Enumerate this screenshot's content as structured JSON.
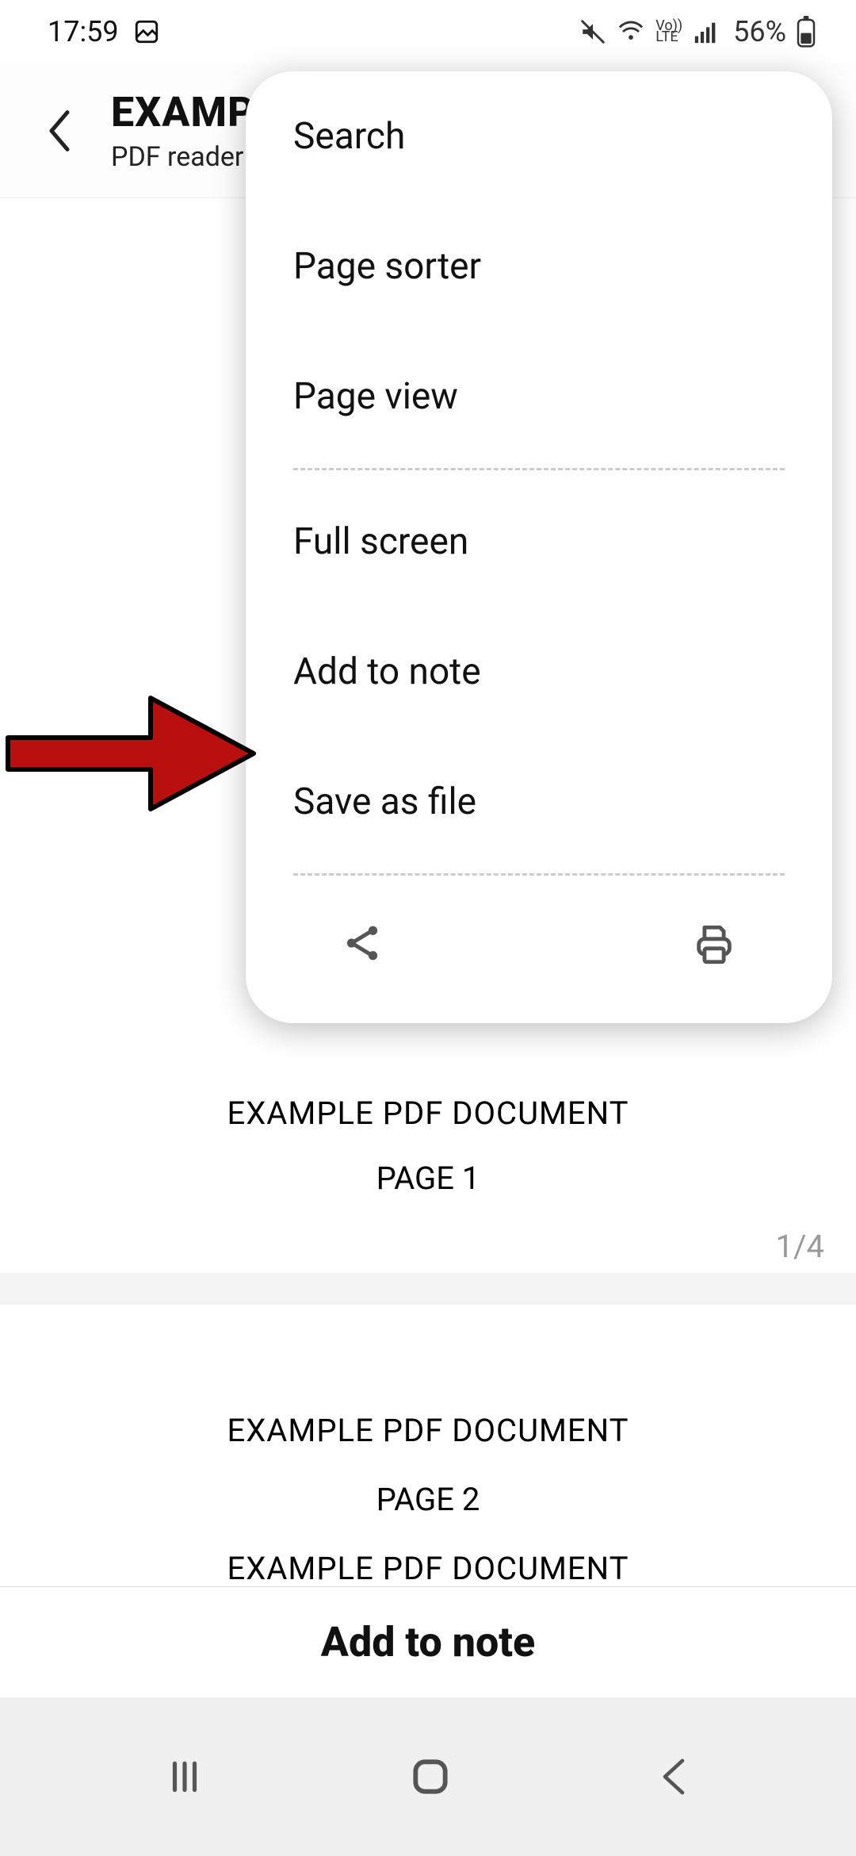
{
  "status": {
    "time": "17:59",
    "battery": "56%"
  },
  "appbar": {
    "title": "EXAMPLE PDF DOCUMEN",
    "subtitle": "PDF reader"
  },
  "menu": {
    "items": {
      "search": "Search",
      "page_sorter": "Page sorter",
      "page_view": "Page view",
      "full_screen": "Full screen",
      "add_to_note": "Add to note",
      "save_as_file": "Save as file"
    }
  },
  "doc": {
    "p1_line1": "EXAMPLE PDF DOCUMENT",
    "p1_line2": "PAGE 1",
    "page_indicator": "1/4",
    "p2_line1": "EXAMPLE PDF DOCUMENT",
    "p2_line2": "PAGE 2",
    "p2_line3": "EXAMPLE PDF DOCUMENT"
  },
  "bottom": {
    "label": "Add to note"
  }
}
